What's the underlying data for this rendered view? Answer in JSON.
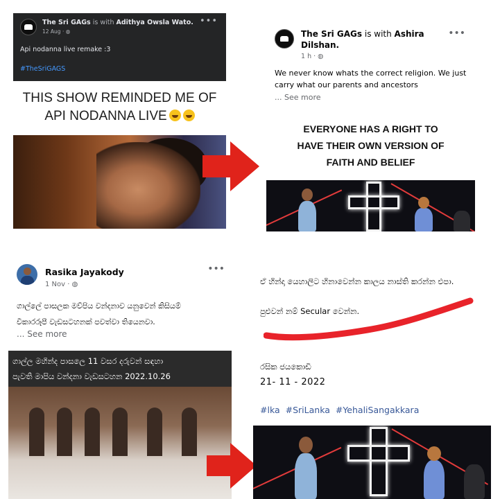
{
  "post1": {
    "page_name": "The Sri GAGs",
    "with_text": "is with",
    "tagged": "Adithya Owsla Wato.",
    "time": "12 Aug · ",
    "text": "Api nodanna live remake :3",
    "hashtag": "#TheSriGAGS",
    "meme_line1": "THIS SHOW REMINDED ME OF",
    "meme_line2": "API NODANNA LIVE",
    "more_icon": "more-dots-icon"
  },
  "post2": {
    "page_name": "The Sri GAGs",
    "with_text": "is with",
    "tagged": "Ashira Dilshan.",
    "time": "1 h · ",
    "text": "We never know whats the correct religion. We just carry what our parents and ancestors",
    "see_more": "... See more",
    "meme_line1": "EVERYONE HAS A RIGHT TO",
    "meme_line2": "HAVE THEIR OWN VERSION OF",
    "meme_line3": "FAITH AND BELIEF"
  },
  "post3": {
    "author": "Rasika Jayakody",
    "time": "1 Nov · ",
    "text_line1": "ගාල්ලේ පාසලක මව්පිය වන්දනාව යනුවෙන් කිසියම්",
    "text_line2": "වීකාරරූපී වැඩසටහනක් පවත්වා තියෙනවා.",
    "see_more": "... See more",
    "banner_line1": "ගාල්ල මහින්ද පාසලෙ 11 වසර දරුවන් සඳහා",
    "banner_line2": "පැවති මාපිය වන්දනා වැඩසටහන 2022.10.26"
  },
  "post4": {
    "line1": "ඒ හින්දා යෙහාලිට හිනාවෙන්න කාලය නාස්ති කරන්න එපා.",
    "line2": "පුළුවන් නම් Secular වෙන්න.",
    "signature": "රසික ජයකොඩි",
    "date": "21- 11 - 2022",
    "hashtags": [
      "#lka",
      "#SriLanka",
      "#YehaliSangakkara"
    ]
  },
  "colors": {
    "arrow_red": "#e0231b",
    "scribble_red": "#e8232a",
    "hashtag_blue": "#385898",
    "dark_bg": "#242526"
  }
}
